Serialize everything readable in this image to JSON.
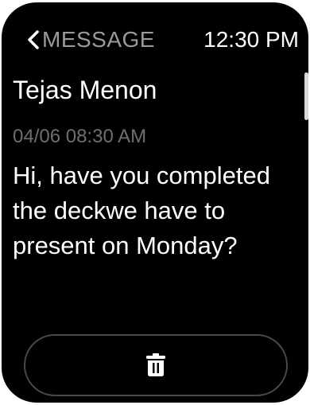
{
  "header": {
    "back_label": "MESSAGE",
    "back_icon": "chevron-left-icon",
    "time": "12:30 PM"
  },
  "message": {
    "sender": "Tejas Menon",
    "timestamp": "04/06 08:30 AM",
    "body": "Hi, have you completed the deckwe have to present on Monday?"
  },
  "actions": {
    "delete_icon": "trash-icon"
  },
  "colors": {
    "background": "#000000",
    "primary_text": "#ffffff",
    "secondary_text": "#9a9a9a",
    "timestamp_text": "#6f6f6f",
    "button_border": "#4a4a4a"
  }
}
